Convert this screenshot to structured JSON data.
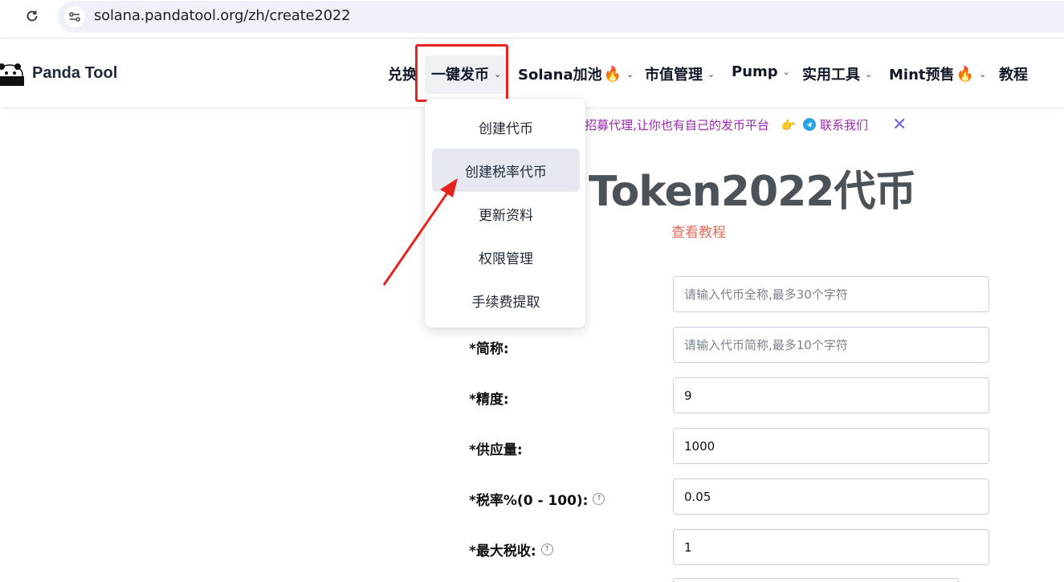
{
  "browser": {
    "url": "solana.pandatool.org/zh/create2022"
  },
  "header": {
    "brand": "Panda Tool",
    "nav": [
      {
        "label": "兑换"
      },
      {
        "label": "一键发币"
      },
      {
        "label": "Solana加池"
      },
      {
        "label": "市值管理"
      },
      {
        "label": "Pump"
      },
      {
        "label": "实用工具"
      },
      {
        "label": "Mint预售"
      },
      {
        "label": "教程"
      }
    ],
    "fire_emoji": "🔥",
    "chevron": "⌄"
  },
  "dropdown": {
    "items": [
      {
        "label": "创建代币"
      },
      {
        "label": "创建税率代币"
      },
      {
        "label": "更新资料"
      },
      {
        "label": "权限管理"
      },
      {
        "label": "手续费提取"
      }
    ],
    "highlighted_index": 1
  },
  "announcement": {
    "text": "l招募代理,让你也有自己的发币平台",
    "pointer_emoji": "👉",
    "contact": "联系我们",
    "close": "✕"
  },
  "main": {
    "title": "Token2022代币",
    "tutorial_link": "查看教程"
  },
  "form": {
    "name": {
      "placeholder": "请输入代币全称,最多30个字符"
    },
    "symbol": {
      "label": "*简称:",
      "placeholder": "请输入代币简称,最多10个字符"
    },
    "decimals": {
      "label": "*精度:",
      "value": "9"
    },
    "supply": {
      "label": "*供应量:",
      "value": "1000"
    },
    "tax_rate": {
      "label": "*税率%(0 - 100):",
      "value": "0.05"
    },
    "max_tax": {
      "label": "*最大税收:",
      "value": "1"
    }
  },
  "colors": {
    "highlight_box": "#e5231f",
    "announcement": "#9b27b0",
    "tutorial_link": "#e06c5c",
    "heading": "#4b5358"
  }
}
